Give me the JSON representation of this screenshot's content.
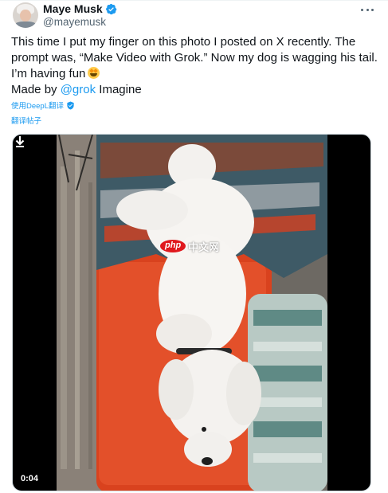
{
  "author": {
    "display_name": "Maye Musk",
    "handle": "@mayemusk",
    "verified_icon": "verified-badge-icon",
    "avatar_icon": "avatar"
  },
  "tweet": {
    "line1": "This time I put my finger on this photo I posted on X recently. The prompt was, “Make Video with Grok.” Now my dog is wagging his tail. I’m having fun",
    "made_by_prefix": "Made by ",
    "mention": "@grok",
    "made_by_suffix": " Imagine",
    "emoji": "star-struck-emoji"
  },
  "translation": {
    "deepl_label": "使用DeepL翻译",
    "translate_post_label": "翻译帖子"
  },
  "video": {
    "timestamp": "0:04",
    "download_icon": "download-icon",
    "watermark_logo": "php",
    "watermark_text": "中文网"
  },
  "colors": {
    "accent": "#1d9bf0",
    "text_primary": "#0f1419",
    "text_secondary": "#536471",
    "video_bg": "#000000"
  }
}
